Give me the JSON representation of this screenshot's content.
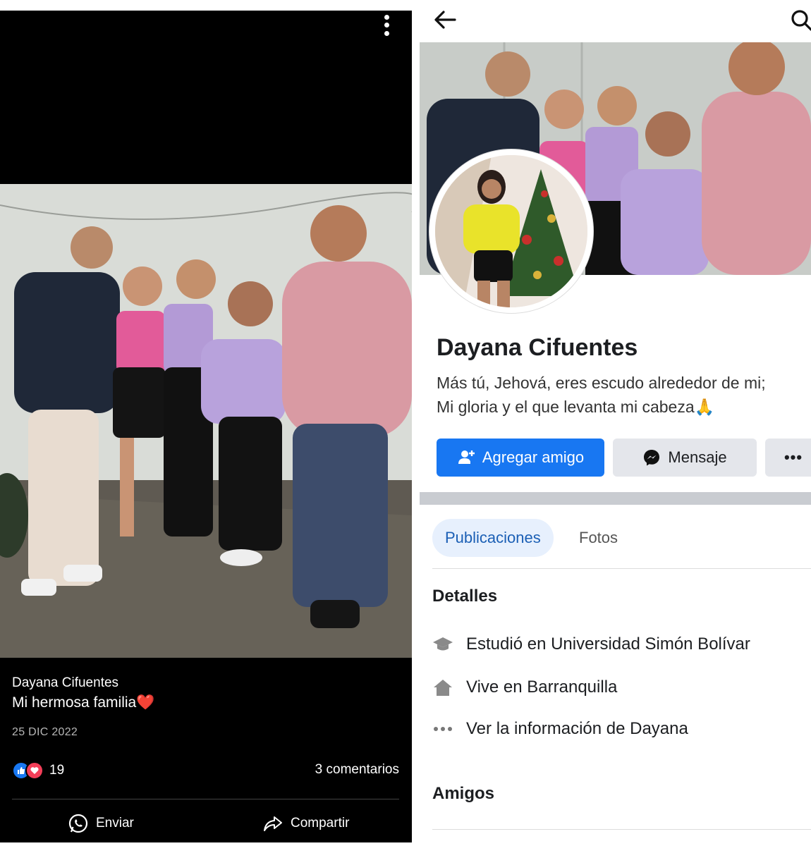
{
  "post": {
    "author": "Dayana Cifuentes",
    "caption": "Mi hermosa familia",
    "caption_emoji": "❤️",
    "date": "25 DIC 2022",
    "reaction_count": "19",
    "comments": "3 comentarios",
    "send_label": "Enviar",
    "share_label": "Compartir",
    "reaction_icons": [
      "like-icon",
      "love-icon"
    ]
  },
  "profile": {
    "name": "Dayana Cifuentes",
    "bio_line1": "Más tú, Jehová, eres escudo alrededor de mi;",
    "bio_line2": "Mi gloria y el que levanta mi cabeza",
    "bio_emoji": "🙏",
    "add_friend": "Agregar amigo",
    "message": "Mensaje",
    "more": "•••",
    "tabs": [
      "Publicaciones",
      "Fotos"
    ],
    "details_heading": "Detalles",
    "studied_prefix": "Estudió en",
    "studied_place": "Universidad Simón Bolívar",
    "lives_prefix": "Vive en",
    "lives_place": "Barranquilla",
    "see_info": "Ver la información de Dayana",
    "friends_heading": "Amigos"
  },
  "colors": {
    "brand_blue": "#1877f2",
    "love_red": "#f33e58",
    "tab_active_bg": "#e7f0fd"
  }
}
